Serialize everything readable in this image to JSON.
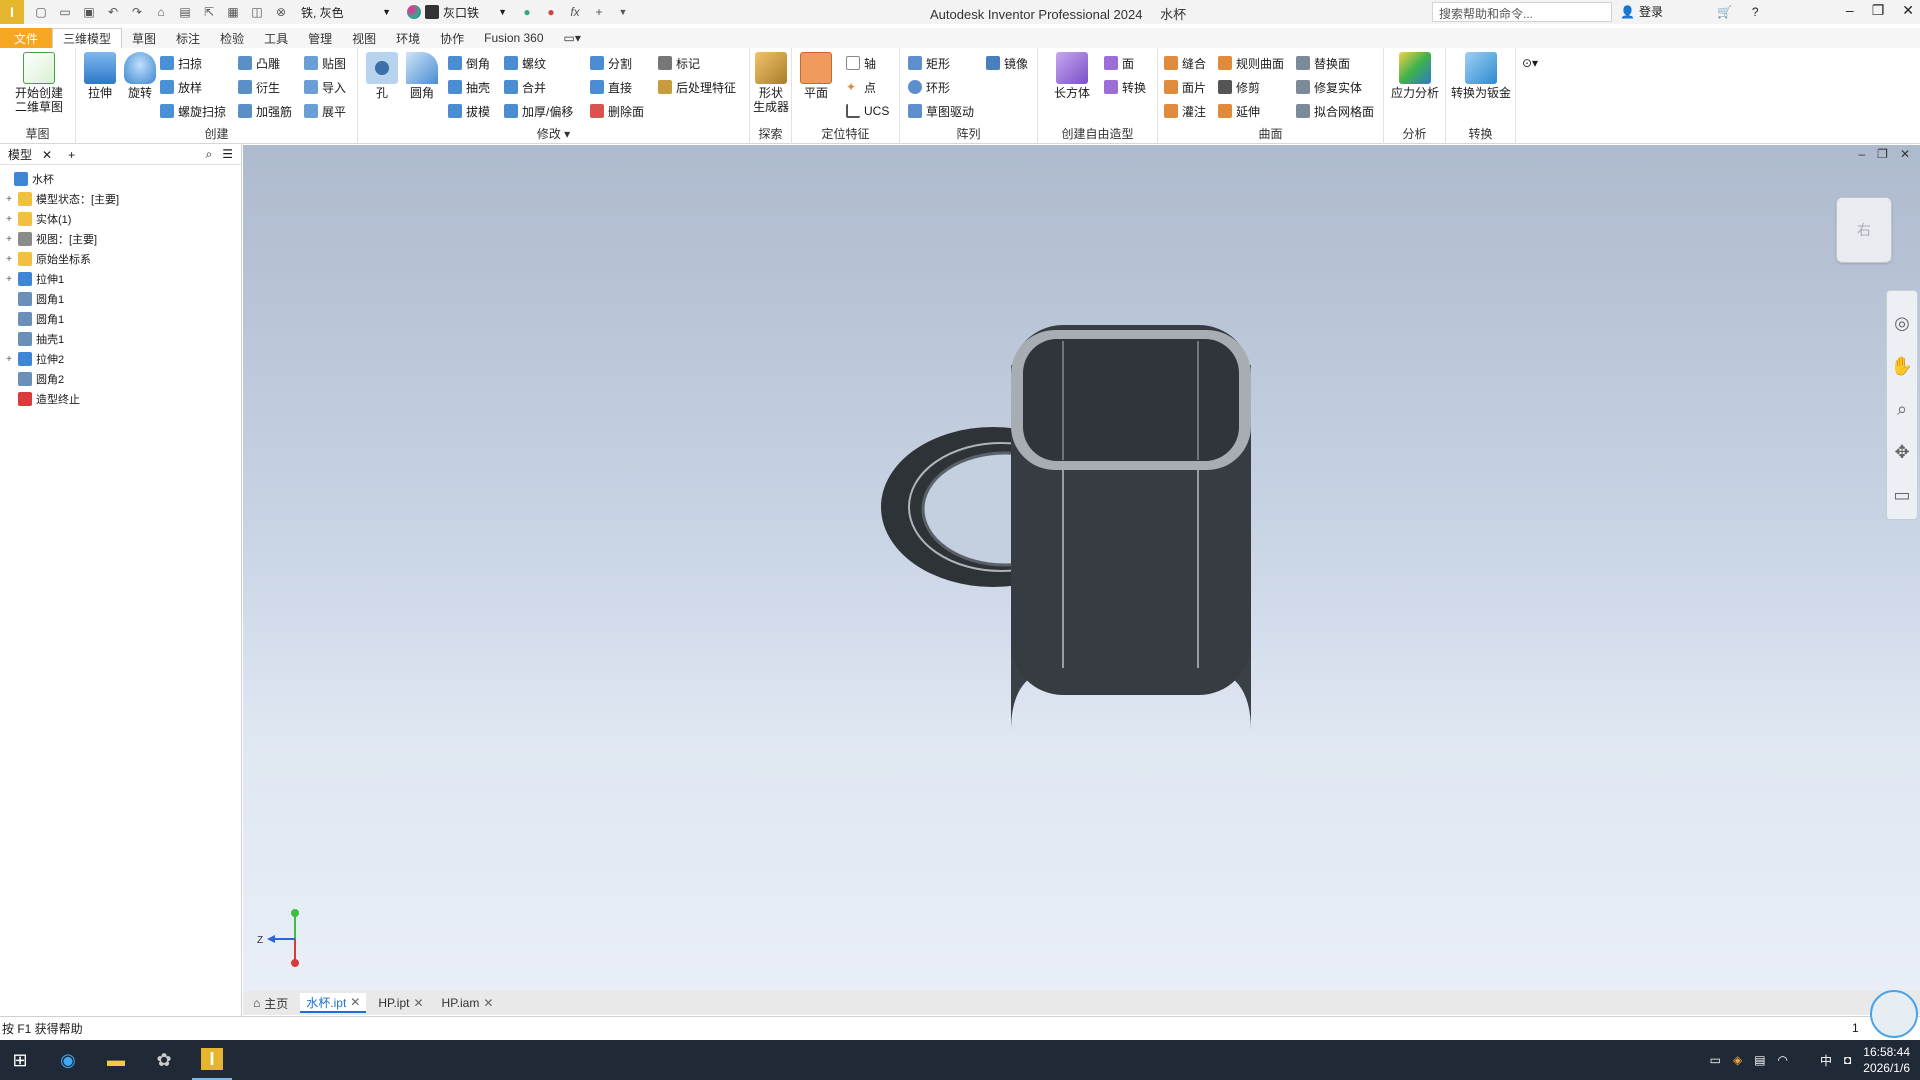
{
  "app": {
    "title": "Autodesk Inventor Professional 2024",
    "document": "水杯",
    "logo_letter": "I"
  },
  "qat": {
    "material": "铁, 灰色",
    "appearance": "灰口铁",
    "fx": "fx"
  },
  "search": {
    "placeholder": "搜索帮助和命令..."
  },
  "login": "登录",
  "menu": {
    "file": "文件",
    "tabs": [
      "三维模型",
      "草图",
      "标注",
      "检验",
      "工具",
      "管理",
      "视图",
      "环境",
      "协作",
      "Fusion 360"
    ]
  },
  "ribbon": {
    "sketch": {
      "title": "草图",
      "start_line1": "开始创建",
      "start_line2": "二维草图"
    },
    "create": {
      "title": "创建",
      "extrude": "拉伸",
      "revolve": "旋转",
      "sweep": "扫掠",
      "loft": "放样",
      "coil": "螺旋扫掠",
      "emboss": "凸雕",
      "derive": "衍生",
      "rib": "加强筋",
      "decal": "贴图",
      "import": "导入",
      "unfold": "展平"
    },
    "modify": {
      "title": "修改",
      "hole": "孔",
      "fillet": "圆角",
      "chamfer": "倒角",
      "shell": "抽壳",
      "draft": "拔模",
      "thread": "螺纹",
      "combine": "合并",
      "thicken": "加厚/偏移",
      "split": "分割",
      "direct": "直接",
      "delete_face": "删除面",
      "mark": "标记",
      "post_process": "后处理特征"
    },
    "explore": {
      "title": "探索",
      "shape_gen_line1": "形状",
      "shape_gen_line2": "生成器"
    },
    "work": {
      "title": "定位特征",
      "plane": "平面",
      "axis": "轴",
      "point": "点",
      "ucs": "UCS"
    },
    "pattern": {
      "title": "阵列",
      "rect": "矩形",
      "circ": "环形",
      "sketch_driven": "草图驱动",
      "mirror": "镜像"
    },
    "freeform": {
      "title": "创建自由造型",
      "box": "长方体",
      "face": "面",
      "convert": "转换"
    },
    "surface": {
      "title": "曲面",
      "stitch": "缝合",
      "patch": "面片",
      "sculpt": "灌注",
      "ruled": "规则曲面",
      "trim": "修剪",
      "extend": "延伸",
      "replace": "替换面",
      "repair": "修复实体",
      "fit_mesh": "拟合网格面"
    },
    "analysis": {
      "title": "分析",
      "stress": "应力分析"
    },
    "convert": {
      "title": "转换",
      "to_sheetmetal": "转换为钣金"
    }
  },
  "browser": {
    "tab": "模型",
    "tree": [
      {
        "label": "水杯",
        "expand": "",
        "color": "#3f87d6",
        "indent": 0
      },
      {
        "label": "模型状态：[主要]",
        "expand": "+",
        "color": "#f0c040",
        "indent": 1
      },
      {
        "label": "实体(1)",
        "expand": "+",
        "color": "#f0c040",
        "indent": 1
      },
      {
        "label": "视图：[主要]",
        "expand": "+",
        "color": "#8a8a8a",
        "indent": 1
      },
      {
        "label": "原始坐标系",
        "expand": "+",
        "color": "#f0c040",
        "indent": 1
      },
      {
        "label": "拉伸1",
        "expand": "+",
        "color": "#3f87d6",
        "indent": 1
      },
      {
        "label": "圆角1",
        "expand": "",
        "color": "#6a8fb8",
        "indent": 1
      },
      {
        "label": "圆角1",
        "expand": "",
        "color": "#6a8fb8",
        "indent": 1
      },
      {
        "label": "抽壳1",
        "expand": "",
        "color": "#6a8fb8",
        "indent": 1
      },
      {
        "label": "拉伸2",
        "expand": "+",
        "color": "#3f87d6",
        "indent": 1
      },
      {
        "label": "圆角2",
        "expand": "",
        "color": "#6a8fb8",
        "indent": 1
      },
      {
        "label": "造型终止",
        "expand": "",
        "color": "#d83b3b",
        "indent": 1
      }
    ]
  },
  "viewcube": {
    "face": "右"
  },
  "triad": {
    "z": "Z"
  },
  "doc_tabs": {
    "home": "主页",
    "items": [
      {
        "label": "水杯.ipt",
        "active": true
      },
      {
        "label": "HP.ipt",
        "active": false
      },
      {
        "label": "HP.iam",
        "active": false
      }
    ]
  },
  "status": {
    "help": "按 F1 获得帮助",
    "page": "1"
  },
  "taskbar": {
    "ime": "中",
    "time": "16:58:44",
    "date": "2026/1/6"
  }
}
